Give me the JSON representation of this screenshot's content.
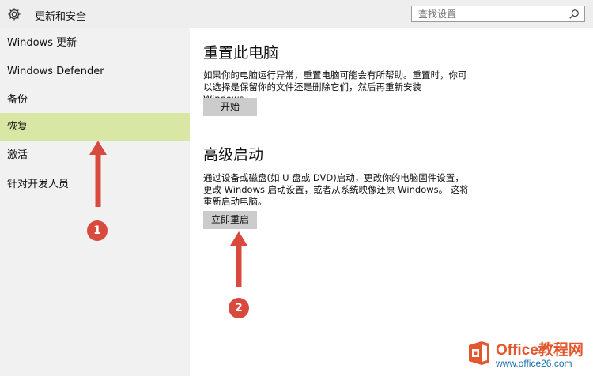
{
  "header": {
    "title": "更新和安全",
    "settings_icon": "gear-icon",
    "search_placeholder": "查找设置",
    "search_value": "",
    "search_icon": "search-icon"
  },
  "sidebar": {
    "items": [
      {
        "label": "Windows 更新"
      },
      {
        "label": "Windows Defender"
      },
      {
        "label": "备份"
      },
      {
        "label": "恢复",
        "selected": true
      },
      {
        "label": "激活"
      },
      {
        "label": "针对开发人员"
      }
    ]
  },
  "main": {
    "reset": {
      "title": "重置此电脑",
      "description": "如果你的电脑运行异常，重置电脑可能会有所帮助。重置时，你可以选择是保留你的文件还是删除它们，然后再重新安装 Windows。",
      "button": "开始"
    },
    "advanced": {
      "title": "高级启动",
      "description": "通过设备或磁盘(如 U 盘或 DVD)启动，更改你的电脑固件设置，更改 Windows 启动设置，或者从系统映像还原 Windows。 这将重新启动电脑。",
      "button": "立即重启"
    }
  },
  "annotations": {
    "badge1": "1",
    "badge2": "2",
    "color": "#d94a3e"
  },
  "watermark": {
    "name": "Office教程网",
    "url": "www.office26.com"
  },
  "colors": {
    "sidebar_selected": "#d9e7a4",
    "button_bg": "#cccccc"
  }
}
